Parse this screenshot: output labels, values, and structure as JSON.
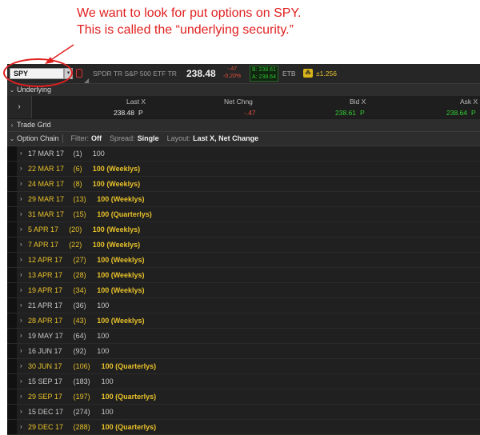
{
  "annotation": {
    "line1": "We want to look for put options on SPY.",
    "line2": "This is called the “underlying security.”",
    "color": "#e02020"
  },
  "toolbar": {
    "symbol": "SPY",
    "description": "SPDR TR S&P 500 ETF TR",
    "last": "238.48",
    "net_change": "-.47",
    "pct_change": "-0.20%",
    "bid": "B: 238.61",
    "ask": "A: 238.64",
    "etb": "ETB",
    "htb_value": "±1.256"
  },
  "underlying": {
    "section_label": "Underlying",
    "headers": {
      "last_x": "Last X",
      "net_chng": "Net Chng",
      "bid_x": "Bid X",
      "ask_x": "Ask X"
    },
    "values": {
      "last": "238.48",
      "last_ex": "P",
      "net_chng": "-.47",
      "bid": "238.61",
      "bid_ex": "P",
      "ask": "238.64",
      "ask_ex": "P"
    }
  },
  "trade_grid": {
    "label": "Trade Grid"
  },
  "option_chain": {
    "label": "Option Chain",
    "filter_label": "Filter:",
    "filter_value": "Off",
    "spread_label": "Spread:",
    "spread_value": "Single",
    "layout_label": "Layout:",
    "layout_value": "Last X, Net Change"
  },
  "expirations": [
    {
      "date": "17 MAR 17",
      "days": "(1)",
      "mult": "100",
      "highlight": false
    },
    {
      "date": "22 MAR 17",
      "days": "(6)",
      "mult": "100 (Weeklys)",
      "highlight": true
    },
    {
      "date": "24 MAR 17",
      "days": "(8)",
      "mult": "100 (Weeklys)",
      "highlight": true
    },
    {
      "date": "29 MAR 17",
      "days": "(13)",
      "mult": "100 (Weeklys)",
      "highlight": true
    },
    {
      "date": "31 MAR 17",
      "days": "(15)",
      "mult": "100 (Quarterlys)",
      "highlight": true
    },
    {
      "date": "5 APR 17",
      "days": "(20)",
      "mult": "100 (Weeklys)",
      "highlight": true
    },
    {
      "date": "7 APR 17",
      "days": "(22)",
      "mult": "100 (Weeklys)",
      "highlight": true
    },
    {
      "date": "12 APR 17",
      "days": "(27)",
      "mult": "100 (Weeklys)",
      "highlight": true
    },
    {
      "date": "13 APR 17",
      "days": "(28)",
      "mult": "100 (Weeklys)",
      "highlight": true
    },
    {
      "date": "19 APR 17",
      "days": "(34)",
      "mult": "100 (Weeklys)",
      "highlight": true
    },
    {
      "date": "21 APR 17",
      "days": "(36)",
      "mult": "100",
      "highlight": false
    },
    {
      "date": "28 APR 17",
      "days": "(43)",
      "mult": "100 (Weeklys)",
      "highlight": true
    },
    {
      "date": "19 MAY 17",
      "days": "(64)",
      "mult": "100",
      "highlight": false
    },
    {
      "date": "16 JUN 17",
      "days": "(92)",
      "mult": "100",
      "highlight": false
    },
    {
      "date": "30 JUN 17",
      "days": "(106)",
      "mult": "100 (Quarterlys)",
      "highlight": true
    },
    {
      "date": "15 SEP 17",
      "days": "(183)",
      "mult": "100",
      "highlight": false
    },
    {
      "date": "29 SEP 17",
      "days": "(197)",
      "mult": "100 (Quarterlys)",
      "highlight": true
    },
    {
      "date": "15 DEC 17",
      "days": "(274)",
      "mult": "100",
      "highlight": false
    },
    {
      "date": "29 DEC 17",
      "days": "(288)",
      "mult": "100 (Quarterlys)",
      "highlight": true
    }
  ]
}
